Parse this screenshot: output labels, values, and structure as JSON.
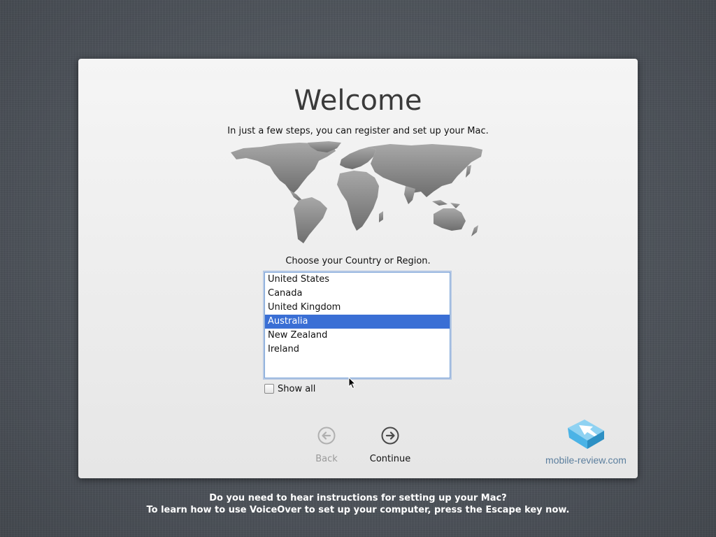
{
  "window": {
    "title": "Welcome",
    "subtitle": "In just a few steps, you can register and set up your Mac."
  },
  "region": {
    "prompt": "Choose your Country or Region.",
    "countries": [
      {
        "label": "United States",
        "selected": false
      },
      {
        "label": "Canada",
        "selected": false
      },
      {
        "label": "United Kingdom",
        "selected": false
      },
      {
        "label": "Australia",
        "selected": true
      },
      {
        "label": "New Zealand",
        "selected": false
      },
      {
        "label": "Ireland",
        "selected": false
      }
    ],
    "show_all_label": "Show all",
    "show_all_checked": false
  },
  "navigation": {
    "back_label": "Back",
    "continue_label": "Continue",
    "back_icon": "arrow-left-circle-icon",
    "continue_icon": "arrow-right-circle-icon"
  },
  "watermark": {
    "text": "mobile-review.com"
  },
  "footer": {
    "line1": "Do you need to hear instructions for setting up your Mac?",
    "line2": "To learn how to use VoiceOver to set up your computer, press the Escape key now."
  },
  "colors": {
    "selection": "#3a6fd5",
    "panel": "#f0f0f0",
    "background": "#50555c",
    "logo": "#4bb3e6"
  }
}
